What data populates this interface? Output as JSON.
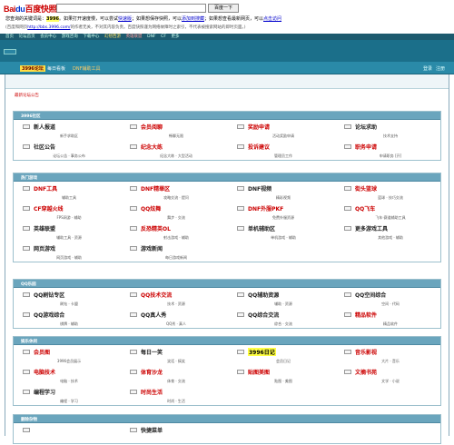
{
  "cache": {
    "logo_text": "Bai",
    "logo_mid": "du",
    "logo_tail": "百度快照",
    "search_button": "百度一下",
    "line1_prefix": "您查询的关键词是：",
    "keyword": "3996",
    "line1_mid": "。如果打开速度慢，可以尝试",
    "link_fast": "快速版",
    "line1_mid2": "；如果想保存快照，可以",
    "link_save": "添加到搜藏",
    "line1_mid3": "；如果想查看最新网页，可以",
    "link_latest": "点击访问",
    "line2_prefix": "(百度和网页",
    "link_site": "http://bbs.3996.com/",
    "line2_suffix": "的作者无关，不对其内容负责。百度快照谨为网络故障时之索引，不代表被搜索网站的即时页面。)"
  },
  "topnav": [
    "首页",
    "论坛首页",
    "会员中心",
    "游戏咨询",
    "下载中心",
    "幻想西游",
    "英雄联盟",
    "DNF",
    "CF",
    "更多"
  ],
  "subnav": {
    "logo": "3996论坛",
    "home": "每日看板",
    "dnf": "DNF辅助工具",
    "right1": "登录",
    "right2": "注册"
  },
  "notice": "最新论坛公告",
  "sections": [
    {
      "key": "main",
      "title": "3996社区",
      "items": [
        {
          "name": "新人报道",
          "desc": "新手求助区",
          "color": "dark"
        },
        {
          "name": "会员阅聊",
          "desc": "畅聊无限",
          "color": "red"
        },
        {
          "name": "奖励申请",
          "desc": "活动奖励申请",
          "color": "red"
        },
        {
          "name": "论坛求助",
          "desc": "技术支持",
          "color": "dark"
        },
        {
          "name": "社区公告",
          "desc": "论坛公告 · 事务公布",
          "color": "dark"
        },
        {
          "name": "纪念大练",
          "desc": "纪念大练 · 大型活动",
          "color": "red"
        },
        {
          "name": "投诉建议",
          "desc": "管理员工作",
          "color": "red"
        },
        {
          "name": "职务申请",
          "desc": "申请职务 [开]",
          "color": "red"
        }
      ]
    },
    {
      "key": "hot",
      "title": "热门游戏",
      "items": [
        {
          "name": "DNF工具",
          "desc": "辅助工具",
          "color": "red"
        },
        {
          "name": "DNF精華区",
          "desc": "攻略交流 · 提问",
          "color": "red"
        },
        {
          "name": "DNF视频",
          "desc": "精彩视频",
          "color": "dark"
        },
        {
          "name": "街头篮球",
          "desc": "篮球 · 技巧交流",
          "color": "red"
        },
        {
          "name": "CF穿越火线",
          "desc": "FPS网游 · 辅助",
          "color": "red"
        },
        {
          "name": "QQ炫舞",
          "desc": "舞步 · 交流",
          "color": "red"
        },
        {
          "name": "DNF外服PKF",
          "desc": "免费外服资源",
          "color": "red"
        },
        {
          "name": "QQ飞车",
          "desc": "飞车·赛道辅助工具",
          "color": "red"
        },
        {
          "name": "英雄联盟",
          "desc": "辅助工具 · 资源",
          "color": "dark"
        },
        {
          "name": "反恐精英OL",
          "desc": "射击游戏 · 辅助",
          "color": "red"
        },
        {
          "name": "单机辅助区",
          "desc": "单机游戏 · 辅助",
          "color": "dark"
        },
        {
          "name": "更多游戏工具",
          "desc": "其他游戏 · 辅助",
          "color": "dark"
        },
        {
          "name": "网页游戏",
          "desc": "网页游戏 · 辅助",
          "color": "dark"
        },
        {
          "name": "游戏新闻",
          "desc": "每日游戏新闻",
          "color": "dark"
        }
      ]
    },
    {
      "key": "qq",
      "title": "QQ乐园",
      "items": [
        {
          "name": "QQ刷钻专区",
          "desc": "刷钻 · 卡盟",
          "color": "dark"
        },
        {
          "name": "QQ技术交流",
          "desc": "技术 · 资源",
          "color": "red"
        },
        {
          "name": "QQ辅助资源",
          "desc": "辅助 · 资源",
          "color": "dark"
        },
        {
          "name": "QQ空间综合",
          "desc": "空间 · 代码",
          "color": "dark"
        },
        {
          "name": "QQ游戏综合",
          "desc": "棋牌 · 辅助",
          "color": "dark"
        },
        {
          "name": "QQ真人秀",
          "desc": "QQ秀 · 真人",
          "color": "dark"
        },
        {
          "name": "QQ综合交流",
          "desc": "综合 · 交流",
          "color": "dark"
        },
        {
          "name": "精品软件",
          "desc": "精品软件",
          "color": "red"
        }
      ]
    },
    {
      "key": "life",
      "title": "娱乐休闲",
      "items": [
        {
          "name": "会员图",
          "desc": "3996会员展示",
          "color": "red"
        },
        {
          "name": "每日一笑",
          "desc": "笑话 · 搞笑",
          "color": "dark"
        },
        {
          "name": "3996日记",
          "desc": "会员日记",
          "color": "dark",
          "highlight": true
        },
        {
          "name": "音乐影视",
          "desc": "大片 · 音乐",
          "color": "red"
        },
        {
          "name": "电脑技术",
          "desc": "电脑 · 技术",
          "color": "red"
        },
        {
          "name": "体育沙龙",
          "desc": "体育 · 交流",
          "color": "red"
        },
        {
          "name": "贴图美图",
          "desc": "贴图 · 美图",
          "color": "red"
        },
        {
          "name": "文摘书苑",
          "desc": "文学 · 小说",
          "color": "red"
        },
        {
          "name": "编程学习",
          "desc": "编程 · 学习",
          "color": "dark"
        },
        {
          "name": "时尚生活",
          "desc": "时尚 · 生活",
          "color": "red"
        }
      ]
    },
    {
      "key": "tail",
      "title": "删除杂物",
      "items": [
        {
          "name": "",
          "desc": "",
          "color": "dark"
        },
        {
          "name": "快捷菜单",
          "desc": "",
          "color": "dark"
        }
      ]
    }
  ]
}
